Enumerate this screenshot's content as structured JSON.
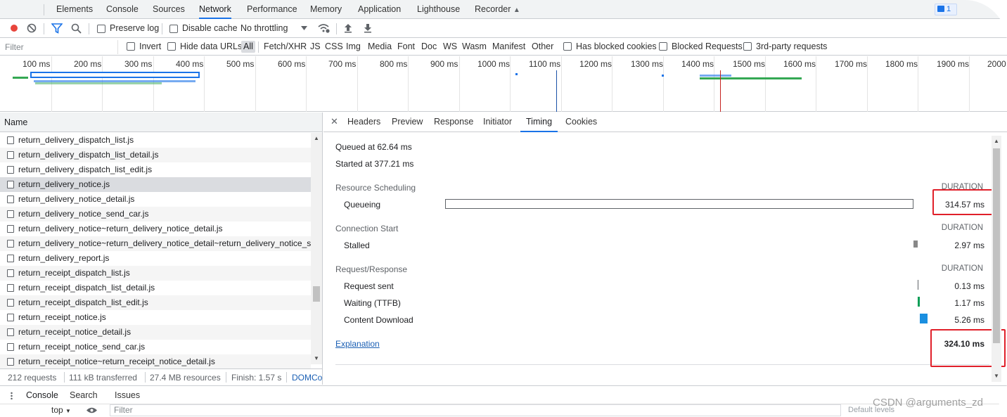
{
  "tabs": [
    "Elements",
    "Console",
    "Sources",
    "Network",
    "Performance",
    "Memory",
    "Application",
    "Lighthouse",
    "Recorder"
  ],
  "active_tab": "Network",
  "issues_badge": "1",
  "toolbar": {
    "preserve_log": "Preserve log",
    "disable_cache": "Disable cache",
    "throttling": "No throttling"
  },
  "filter": {
    "placeholder": "Filter",
    "invert": "Invert",
    "hide_data_urls": "Hide data URLs",
    "types": [
      "All",
      "Fetch/XHR",
      "JS",
      "CSS",
      "Img",
      "Media",
      "Font",
      "Doc",
      "WS",
      "Wasm",
      "Manifest",
      "Other"
    ],
    "selected_type": "All",
    "blocked_cookies": "Has blocked cookies",
    "blocked_requests": "Blocked Requests",
    "third_party": "3rd-party requests"
  },
  "overview": {
    "ticks": [
      "100 ms",
      "200 ms",
      "300 ms",
      "400 ms",
      "500 ms",
      "600 ms",
      "700 ms",
      "800 ms",
      "900 ms",
      "1000 ms",
      "1100 ms",
      "1200 ms",
      "1300 ms",
      "1400 ms",
      "1500 ms",
      "1600 ms",
      "1700 ms",
      "1800 ms",
      "1900 ms",
      "2000"
    ],
    "colors": {
      "blue": "#1a73e8",
      "green": "#34a853",
      "red_line": "#c5221f",
      "dark_blue_line": "#1a52a8"
    }
  },
  "requests": {
    "column_name": "Name",
    "items": [
      "return_delivery_dispatch_list.js",
      "return_delivery_dispatch_list_detail.js",
      "return_delivery_dispatch_list_edit.js",
      "return_delivery_notice.js",
      "return_delivery_notice_detail.js",
      "return_delivery_notice_send_car.js",
      "return_delivery_notice~return_delivery_notice_detail.js",
      "return_delivery_notice~return_delivery_notice_detail~return_delivery_notice_se",
      "return_delivery_report.js",
      "return_receipt_dispatch_list.js",
      "return_receipt_dispatch_list_detail.js",
      "return_receipt_dispatch_list_edit.js",
      "return_receipt_notice.js",
      "return_receipt_notice_detail.js",
      "return_receipt_notice_send_car.js",
      "return_receipt_notice~return_receipt_notice_detail.js"
    ],
    "selected": "return_delivery_notice.js"
  },
  "status_bar": {
    "requests": "212 requests",
    "transferred": "111 kB transferred",
    "resources": "27.4 MB resources",
    "finish": "Finish: 1.57 s",
    "domcontent": "DOMCo"
  },
  "detail_tabs": [
    "Headers",
    "Preview",
    "Response",
    "Initiator",
    "Timing",
    "Cookies"
  ],
  "detail_active_tab": "Timing",
  "timing": {
    "queued_at": "Queued at 62.64 ms",
    "started_at": "Started at 377.21 ms",
    "duration_label": "DURATION",
    "sections": [
      {
        "title": "Resource Scheduling",
        "rows": [
          {
            "label": "Queueing",
            "value": "314.57 ms"
          }
        ]
      },
      {
        "title": "Connection Start",
        "rows": [
          {
            "label": "Stalled",
            "value": "2.97 ms"
          }
        ]
      },
      {
        "title": "Request/Response",
        "rows": [
          {
            "label": "Request sent",
            "value": "0.13 ms"
          },
          {
            "label": "Waiting (TTFB)",
            "value": "1.17 ms"
          },
          {
            "label": "Content Download",
            "value": "5.26 ms"
          }
        ]
      }
    ],
    "explanation": "Explanation",
    "total": "324.10 ms",
    "colors": {
      "stalled": "#888888",
      "waiting": "#0b9e57",
      "download": "#1a8fe0",
      "highlight": "#e0202a"
    }
  },
  "drawer": {
    "tabs": [
      "Console",
      "Search",
      "Issues"
    ],
    "context": "top",
    "filter_placeholder": "Filter",
    "levels": "Default levels",
    "watermark": "CSDN @arguments_zd"
  }
}
